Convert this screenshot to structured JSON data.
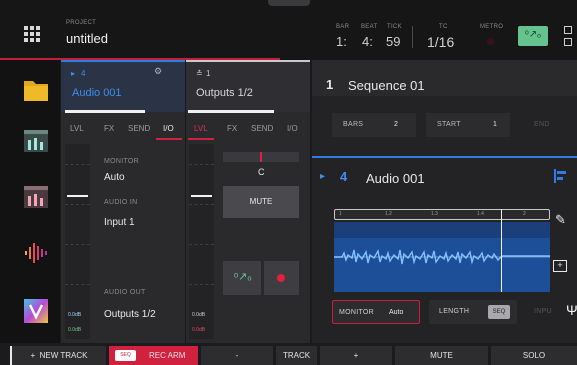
{
  "header": {
    "project_label": "PROJECT",
    "project_name": "untitled",
    "bar_label": "BAR",
    "beat_label": "BEAT",
    "tick_label": "TICK",
    "bar_value": "1:",
    "beat_value": "4:",
    "tick_value": "59",
    "tc_label": "TC",
    "tc_value": "1/16",
    "metro_label": "METRO"
  },
  "tracks": [
    {
      "number": "4",
      "name": "Audio 001",
      "tabs": [
        "LVL",
        "FX",
        "SEND",
        "I/O"
      ],
      "active_tab": "I/O",
      "monitor_label": "MONITOR",
      "monitor_value": "Auto",
      "audio_in_label": "AUDIO IN",
      "audio_in_value": "Input 1",
      "audio_out_label": "AUDIO OUT",
      "audio_out_value": "Outputs 1/2",
      "gain_top": "0.0dB",
      "gain_bottom": "0.0dB"
    },
    {
      "number": "1",
      "name": "Outputs 1/2",
      "tabs": [
        "LVL",
        "FX",
        "SEND",
        "I/O"
      ],
      "active_tab": "LVL",
      "pan_value": "C",
      "mute_label": "MUTE",
      "gain_top": "0.0dB",
      "gain_bottom": "0.0dB"
    }
  ],
  "sequence": {
    "number": "1",
    "name": "Sequence 01",
    "bars_label": "BARS",
    "bars_value": "2",
    "start_label": "START",
    "start_value": "1",
    "end_label": "END"
  },
  "audio_track": {
    "number": "4",
    "name": "Audio 001",
    "ruler_marks": [
      "1",
      "1.2",
      "1.3",
      "1.4",
      "2"
    ],
    "monitor_label": "MONITOR",
    "monitor_value": "Auto",
    "length_label": "LENGTH",
    "length_value": "SEQ",
    "input_label": "INPU"
  },
  "bottom": {
    "new_track": "NEW TRACK",
    "seq_badge": "SEQ",
    "rec_arm": "REC ARM",
    "minus": "-",
    "track": "TRACK",
    "plus": "+",
    "mute": "MUTE",
    "solo": "SOLO"
  },
  "colors": {
    "accent_blue": "#2f7de0",
    "accent_red": "#d0213f",
    "metro_green": "#65c48e"
  }
}
